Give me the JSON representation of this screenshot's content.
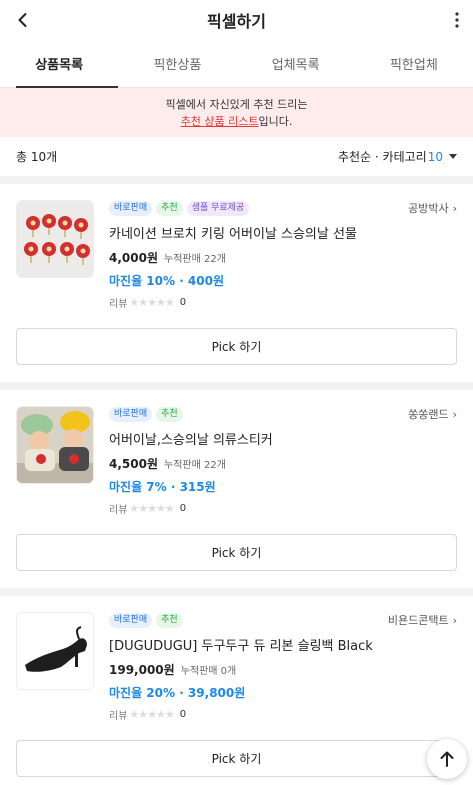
{
  "header": {
    "title": "픽셀하기"
  },
  "tabs": [
    {
      "label": "상품목록"
    },
    {
      "label": "픽한상품"
    },
    {
      "label": "업체목록"
    },
    {
      "label": "픽한업체"
    }
  ],
  "notice": {
    "line1": "픽셀에서 자신있게 추천 드리는",
    "link": "추천 상품 리스트",
    "suffix": "입니다."
  },
  "summary": {
    "total": "총 10개",
    "sort": "추천순 · 카테고리",
    "count": "10"
  },
  "products": [
    {
      "badges": [
        "바로판매",
        "추천",
        "샘플 무료제공"
      ],
      "vendor": "공방박사",
      "name": "카네이션 브로치 키링 어버이날 스승의날 선물",
      "price": "4,000원",
      "sold": "누적판매 22개",
      "margin": "마진율 10% · 400원",
      "review_label": "리뷰",
      "review_count": "0",
      "pick": "Pick 하기"
    },
    {
      "badges": [
        "바로판매",
        "추천"
      ],
      "vendor": "쏭쏭랜드",
      "name": "어버이날,스승의날 의류스티커",
      "price": "4,500원",
      "sold": "누적판매 22개",
      "margin": "마진율 7% · 315원",
      "review_label": "리뷰",
      "review_count": "0",
      "pick": "Pick 하기"
    },
    {
      "badges": [
        "바로판매",
        "추천"
      ],
      "vendor": "비욘드콘택트",
      "name": "[DUGUDUGU] 두구두구 듀 리본 슬링백 Black",
      "price": "199,000원",
      "sold": "누적판매 0개",
      "margin": "마진율 20% · 39,800원",
      "review_label": "리뷰",
      "review_count": "0",
      "pick": "Pick 하기"
    }
  ]
}
